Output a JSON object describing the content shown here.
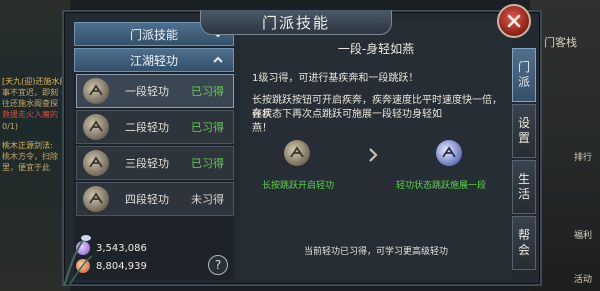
{
  "window": {
    "title": "门派技能"
  },
  "background": {
    "left_lines": [
      "[天九(迎)还施水阁]",
      "事不宜迟，即刻",
      "往还施水阁查探",
      "救援走火入魔的",
      "0/1)",
      "桃木正源剑法:",
      "桃木方令，扫除",
      "里，便宜于此"
    ],
    "right_lines": [
      "门客栈",
      "排行",
      "福利",
      "活动"
    ]
  },
  "left_panel": {
    "sect_header": "门派技能",
    "qinggong_header": "江湖轻功",
    "skills": [
      {
        "name": "一段轻功",
        "status": "已习得",
        "learned": true
      },
      {
        "name": "二段轻功",
        "status": "已习得",
        "learned": true
      },
      {
        "name": "三段轻功",
        "status": "已习得",
        "learned": true
      },
      {
        "name": "四段轻功",
        "status": "未习得",
        "learned": false
      }
    ],
    "currency": [
      {
        "name": "silver",
        "value": "3,543,086",
        "icon": "silver-ingot-icon"
      },
      {
        "name": "gold",
        "value": "8,804,939",
        "icon": "gold-ingot-icon"
      }
    ],
    "help_label": "?"
  },
  "detail": {
    "title": "一段-身轻如燕",
    "lines": [
      "1级习得，可进行基疾奔和一段跳跃！",
      "长按跳跃按钮可开启疾奔，疾奔速度比平时速度快一倍，在疾",
      "奔状态下再次点跳跃可施展一段轻功身轻如",
      "燕！"
    ],
    "demo_left_label": "长按跳跃开启轻功",
    "demo_right_label": "轻功状态跳跃施展一段",
    "bottom_note": "当前轻功已习得，可学习更高级轻功"
  },
  "side_tabs": [
    {
      "label": "门派",
      "active": true
    },
    {
      "label": "设置",
      "active": false
    },
    {
      "label": "生活",
      "active": false
    },
    {
      "label": "帮会",
      "active": false
    }
  ],
  "colors": {
    "learned": "#5fd14a",
    "accent": "#4e6f8d",
    "close": "#c63a2e"
  }
}
